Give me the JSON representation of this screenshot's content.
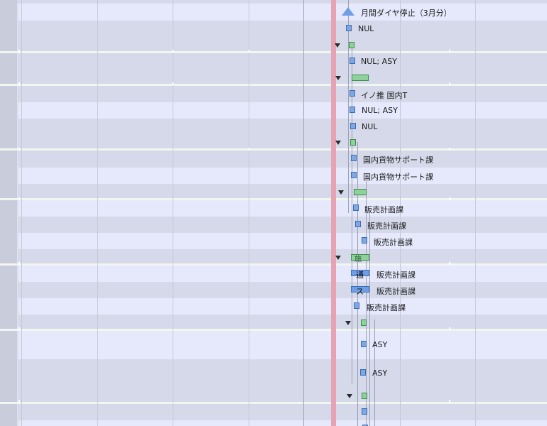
{
  "rows": [
    {
      "type": "task",
      "label": "月間ダイヤ停止（3月分）",
      "icon": "milestone-triangle-icon"
    },
    {
      "type": "task",
      "label": "NUL",
      "icon": "milestone-icon"
    },
    {
      "type": "summary",
      "label": "",
      "icon": "summary-icon"
    },
    {
      "type": "task",
      "label": "NUL; ASY",
      "icon": "milestone-icon"
    },
    {
      "type": "summary",
      "label": "",
      "icon": "summary-icon"
    },
    {
      "type": "task",
      "label": "イノ推 国内T",
      "icon": "milestone-icon"
    },
    {
      "type": "task",
      "label": "NUL; ASY",
      "icon": "milestone-icon"
    },
    {
      "type": "task",
      "label": "NUL",
      "icon": "milestone-icon"
    },
    {
      "type": "summary",
      "label": "",
      "icon": "summary-icon"
    },
    {
      "type": "task",
      "label": "国内貨物サポート課",
      "icon": "milestone-icon"
    },
    {
      "type": "task",
      "label": "国内貨物サポート課",
      "icon": "milestone-icon"
    },
    {
      "type": "summary",
      "label": "",
      "icon": "summary-icon"
    },
    {
      "type": "task",
      "label": "販売計画課",
      "icon": "milestone-icon"
    },
    {
      "type": "task",
      "label": "販売計画課",
      "icon": "milestone-icon"
    },
    {
      "type": "task",
      "label": "販売計画課",
      "icon": "milestone-icon"
    },
    {
      "type": "summary",
      "label": "",
      "icon": "summary-icon",
      "bar_text": "施"
    },
    {
      "type": "task",
      "label": "販売計画課",
      "icon": "task-bar-icon",
      "bar_text": "通"
    },
    {
      "type": "task",
      "label": "販売計画課",
      "icon": "task-bar-icon",
      "bar_text": "ス"
    },
    {
      "type": "task",
      "label": "販売計画課",
      "icon": "milestone-icon"
    },
    {
      "type": "summary",
      "label": "",
      "icon": "summary-icon"
    },
    {
      "type": "task",
      "label": "ASY",
      "icon": "milestone-icon"
    },
    {
      "type": "task",
      "label": "ASY",
      "icon": "milestone-icon"
    },
    {
      "type": "summary",
      "label": "",
      "icon": "summary-icon"
    },
    {
      "type": "task",
      "label": "",
      "icon": "milestone-icon"
    },
    {
      "type": "task",
      "label": "",
      "icon": "milestone-icon"
    }
  ],
  "colors": {
    "today_line": "#e7a3b4",
    "task_fill": "#6f9ee6",
    "summary_fill": "#8fd19a",
    "row_even": "#e6e9fb",
    "row_odd": "#d5d9ea"
  }
}
